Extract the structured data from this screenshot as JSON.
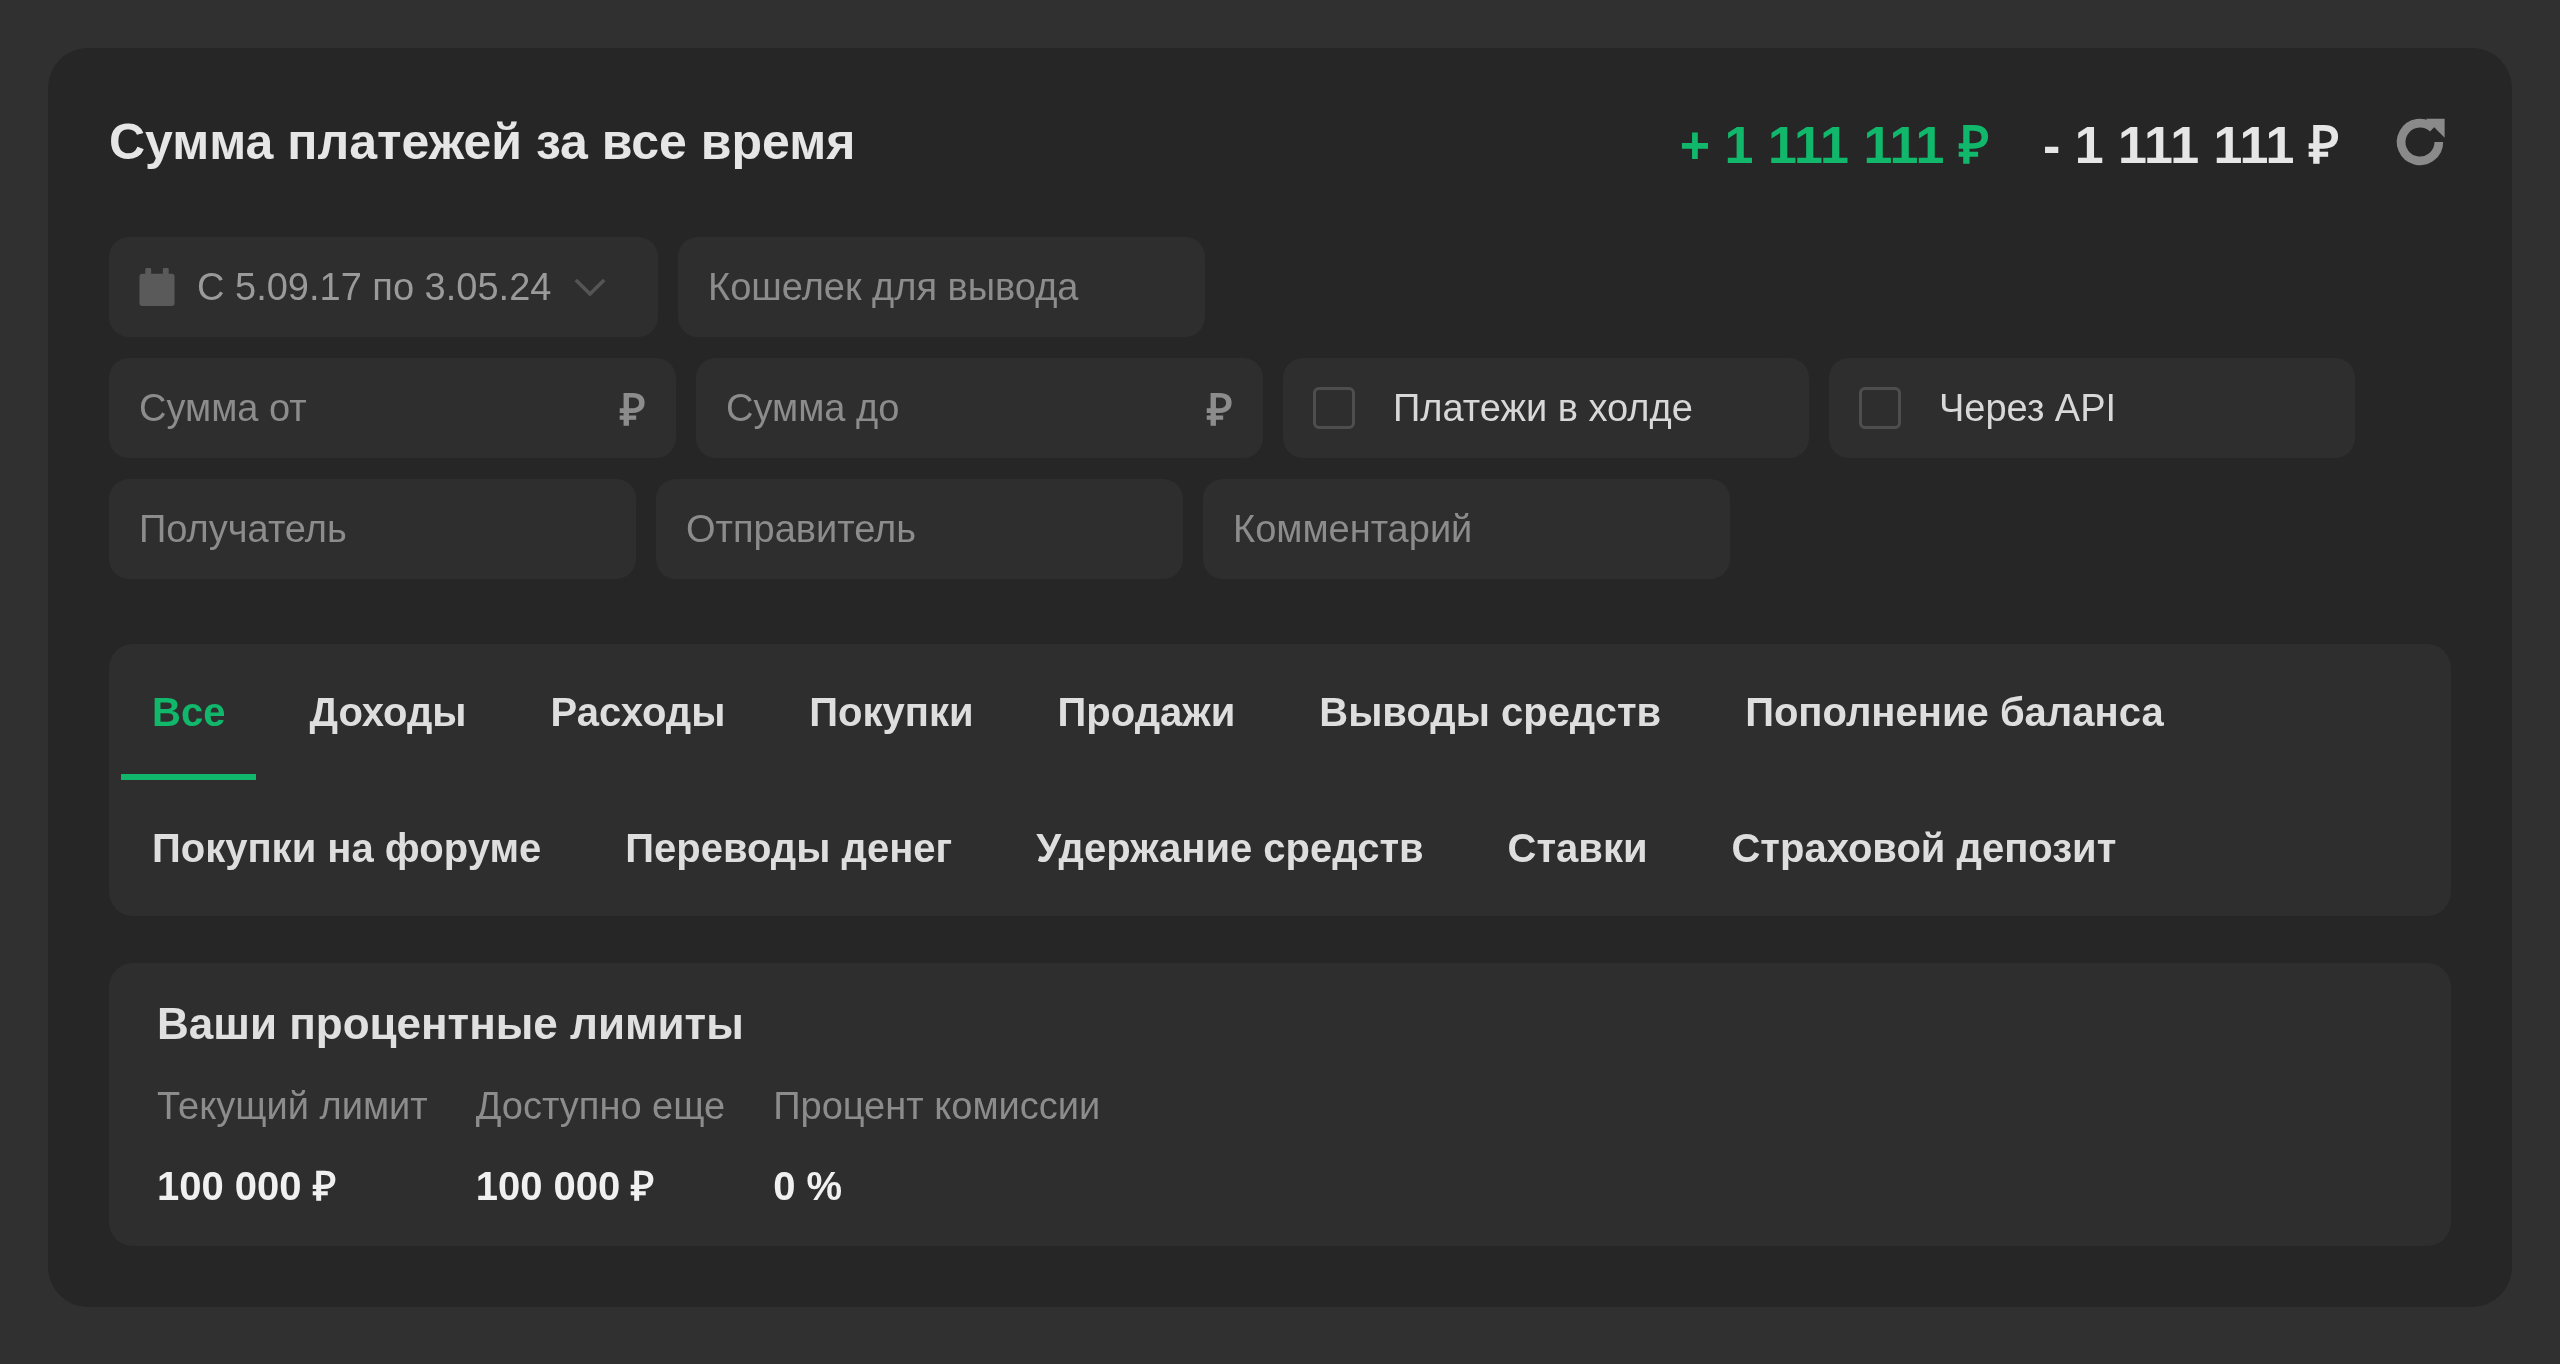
{
  "header": {
    "title": "Сумма платежей за все время",
    "income": "+ 1 111 111 ₽",
    "expense": "- 1 111 111 ₽"
  },
  "filters": [
    [
      {
        "kind": "date",
        "value": "С 5.09.17 по 3.05.24"
      },
      {
        "kind": "text",
        "placeholder": "Кошелек для вывода"
      }
    ],
    [
      {
        "kind": "currency",
        "placeholder": "Сумма от",
        "suffix": "₽"
      },
      {
        "kind": "currency",
        "placeholder": "Сумма до",
        "suffix": "₽"
      },
      {
        "kind": "checkbox",
        "label": "Платежи в холде",
        "checked": false
      },
      {
        "kind": "checkbox",
        "label": "Через API",
        "checked": false
      }
    ],
    [
      {
        "kind": "text",
        "placeholder": "Получатель"
      },
      {
        "kind": "text",
        "placeholder": "Отправитель"
      },
      {
        "kind": "text",
        "placeholder": "Комментарий"
      }
    ]
  ],
  "tabs": [
    [
      {
        "label": "Все",
        "selected": true
      },
      {
        "label": "Доходы",
        "selected": false
      },
      {
        "label": "Расходы",
        "selected": false
      },
      {
        "label": "Покупки",
        "selected": false
      },
      {
        "label": "Продажи",
        "selected": false
      },
      {
        "label": "Выводы средств",
        "selected": false
      },
      {
        "label": "Пополнение баланса",
        "selected": false
      }
    ],
    [
      {
        "label": "Покупки на форуме",
        "selected": false
      },
      {
        "label": "Переводы денег",
        "selected": false
      },
      {
        "label": "Удержание средств",
        "selected": false
      },
      {
        "label": "Ставки",
        "selected": false
      },
      {
        "label": "Страховой депозит",
        "selected": false
      }
    ]
  ],
  "limits": {
    "title": "Ваши процентные лимиты",
    "items": [
      {
        "label": "Текущий лимит",
        "value": "100 000 ₽"
      },
      {
        "label": "Доступно еще",
        "value": "100 000 ₽"
      },
      {
        "label": "Процент комиссии",
        "value": "0 %"
      }
    ]
  }
}
